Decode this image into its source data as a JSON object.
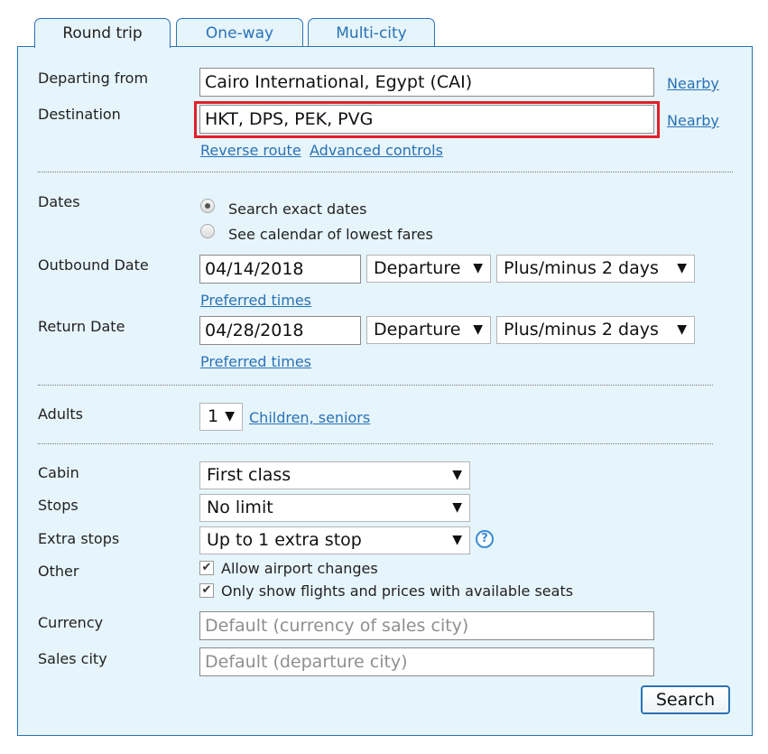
{
  "tabs": [
    {
      "label": "Round trip",
      "active": true
    },
    {
      "label": "One-way",
      "active": false
    },
    {
      "label": "Multi-city",
      "active": false
    }
  ],
  "route": {
    "departing_label": "Departing from",
    "departing_value": "Cairo International, Egypt (CAI)",
    "destination_label": "Destination",
    "destination_value": "HKT, DPS, PEK, PVG",
    "nearby_link": "Nearby",
    "reverse_link": "Reverse route",
    "advanced_link": "Advanced controls"
  },
  "dates": {
    "label": "Dates",
    "option_exact": "Search exact dates",
    "option_calendar": "See calendar of lowest fares",
    "selected": "exact",
    "outbound_label": "Outbound Date",
    "outbound_value": "04/14/2018",
    "outbound_time": "Departure",
    "outbound_flex": "Plus/minus 2 days",
    "return_label": "Return Date",
    "return_value": "04/28/2018",
    "return_time": "Departure",
    "return_flex": "Plus/minus 2 days",
    "preferred_times_link": "Preferred times"
  },
  "passengers": {
    "adults_label": "Adults",
    "adults_value": "1",
    "children_link": "Children, seniors"
  },
  "options": {
    "cabin_label": "Cabin",
    "cabin_value": "First class",
    "stops_label": "Stops",
    "stops_value": "No limit",
    "extra_stops_label": "Extra stops",
    "extra_stops_value": "Up to 1 extra stop",
    "other_label": "Other",
    "allow_airport_changes": "Allow airport changes",
    "allow_airport_changes_checked": true,
    "only_available": "Only show flights and prices with available seats",
    "only_available_checked": true,
    "currency_label": "Currency",
    "currency_placeholder": "Default (currency of sales city)",
    "sales_city_label": "Sales city",
    "sales_city_placeholder": "Default (departure city)"
  },
  "actions": {
    "search_label": "Search"
  },
  "icons": {
    "help": "help-icon",
    "dropdown": "chevron-down-icon"
  },
  "colors": {
    "accent": "#2a72b5",
    "panel_bg": "#e6f4fb",
    "highlight": "#e0202a"
  },
  "glyphs": {
    "arrow": "▼",
    "check": "✔",
    "question": "?"
  }
}
